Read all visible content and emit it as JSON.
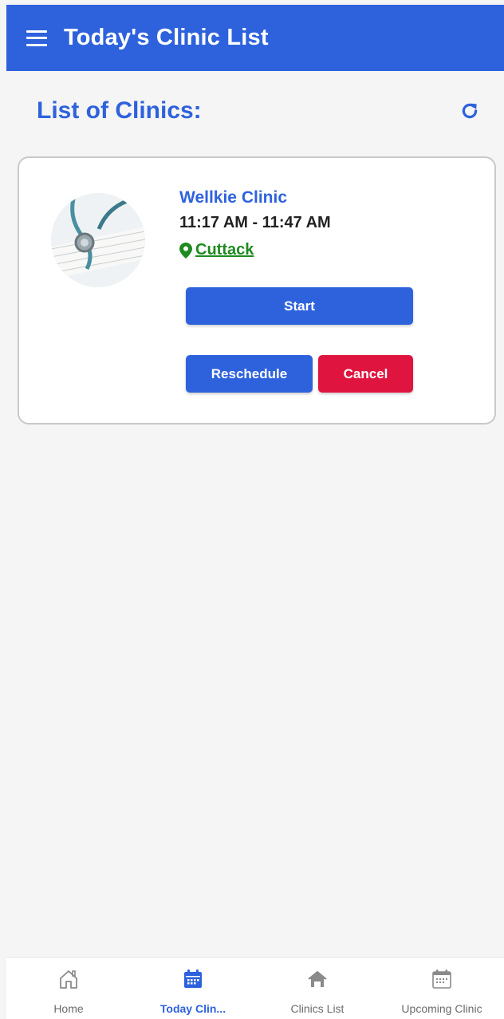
{
  "appbar": {
    "title": "Today's Clinic List",
    "color": "#2e62dd"
  },
  "section": {
    "title": "List of Clinics:"
  },
  "clinics": [
    {
      "name": "Wellkie Clinic",
      "time": "11:17 AM - 11:47 AM",
      "location": "Cuttack",
      "start_label": "Start",
      "reschedule_label": "Reschedule",
      "cancel_label": "Cancel"
    }
  ],
  "bottom_nav": [
    {
      "label": "Home",
      "icon": "home-icon",
      "active": false
    },
    {
      "label": "Today Clin...",
      "icon": "calendar-icon",
      "active": true
    },
    {
      "label": "Clinics List",
      "icon": "home-filled-icon",
      "active": false
    },
    {
      "label": "Upcoming Clinic",
      "icon": "calendar-outline-icon",
      "active": false
    }
  ],
  "colors": {
    "primary": "#2e62dd",
    "danger": "#e0153f",
    "location": "#1f8a1f"
  }
}
